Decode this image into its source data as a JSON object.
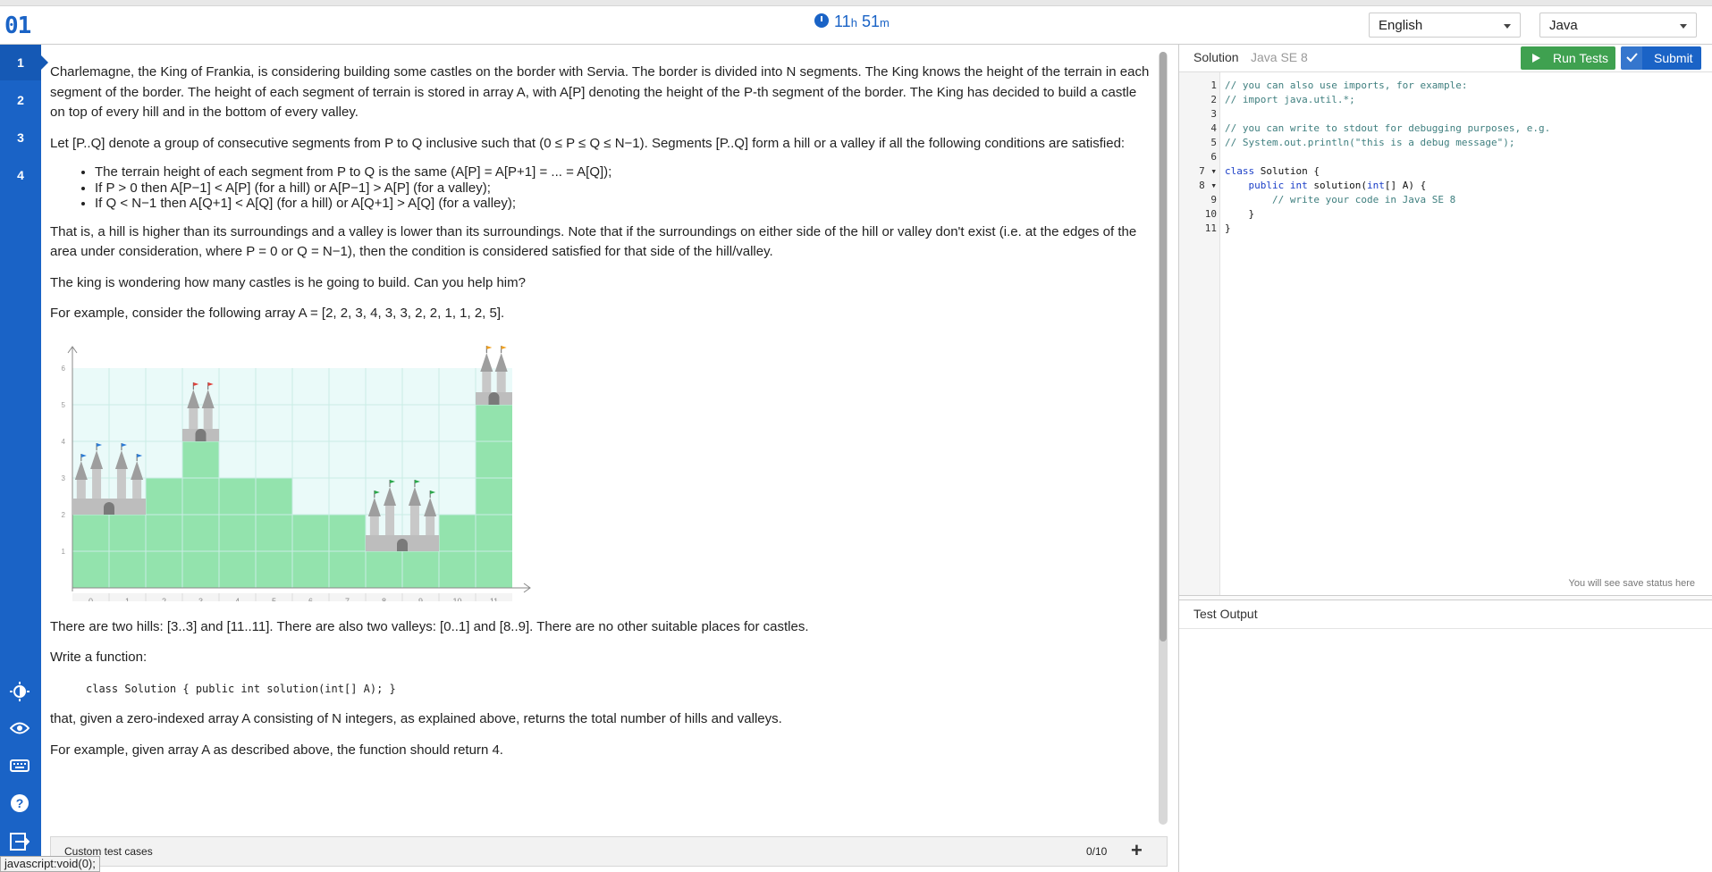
{
  "header": {
    "logo": "01",
    "timer_hours": "11",
    "timer_h_unit": "h",
    "timer_minutes": "51",
    "timer_m_unit": "m",
    "language_select": "English",
    "prog_language_select": "Java"
  },
  "sidebar": {
    "tasks": [
      "1",
      "2",
      "3",
      "4"
    ],
    "icons": [
      "brightness-icon",
      "eye-icon",
      "keyboard-icon",
      "help-icon",
      "exit-icon"
    ]
  },
  "description": {
    "p1": "Charlemagne, the King of Frankia, is considering building some castles on the border with Servia. The border is divided into N segments. The King knows the height of the terrain in each segment of the border. The height of each segment of terrain is stored in array A, with A[P] denoting the height of the P-th segment of the border. The King has decided to build a castle on top of every hill and in the bottom of every valley.",
    "p2": "Let [P..Q] denote a group of consecutive segments from P to Q inclusive such that (0 ≤ P ≤ Q ≤ N−1). Segments [P..Q] form a hill or a valley if all the following conditions are satisfied:",
    "bullets": [
      "The terrain height of each segment from P to Q is the same (A[P] = A[P+1] = ... = A[Q]);",
      "If P > 0 then A[P−1] < A[P] (for a hill) or A[P−1] > A[P] (for a valley);",
      "If Q < N−1 then A[Q+1] < A[Q] (for a hill) or A[Q+1] > A[Q] (for a valley);"
    ],
    "p3": "That is, a hill is higher than its surroundings and a valley is lower than its surroundings. Note that if the surroundings on either side of the hill or valley don't exist (i.e. at the edges of the area under consideration, where P = 0 or Q = N−1), then the condition is considered satisfied for that side of the hill/valley.",
    "p4": "The king is wondering how many castles is he going to build. Can you help him?",
    "p5": "For example, consider the following array A = [2, 2, 3, 4, 3, 3, 2, 2, 1, 1, 2, 5].",
    "p6": "There are two hills: [3..3] and [11..11]. There are also two valleys: [0..1] and [8..9]. There are no other suitable places for castles.",
    "p7": "Write a function:",
    "code": "class Solution { public int solution(int[] A); }",
    "p8": "that, given a zero-indexed array A consisting of N integers, as explained above, returns the total number of hills and valleys.",
    "p9": "For example, given array A as described above, the function should return 4."
  },
  "chart_data": {
    "type": "bar",
    "categories": [
      "0",
      "1",
      "2",
      "3",
      "4",
      "5",
      "6",
      "7",
      "8",
      "9",
      "10",
      "11"
    ],
    "values": [
      2,
      2,
      3,
      4,
      3,
      3,
      2,
      2,
      1,
      1,
      2,
      5
    ],
    "xlabel": "",
    "ylabel": "",
    "ylim": [
      0,
      6
    ],
    "yticks": [
      "1",
      "2",
      "3",
      "4",
      "5",
      "6"
    ],
    "grid": true,
    "castles": [
      {
        "segments": [
          0,
          1
        ],
        "flag_color": "#2b7bd6"
      },
      {
        "segments": [
          3
        ],
        "flag_color": "#e0403a"
      },
      {
        "segments": [
          8,
          9
        ],
        "flag_color": "#2aa84a"
      },
      {
        "segments": [
          11
        ],
        "flag_color": "#f0a020"
      }
    ],
    "bar_color": "#93e3ad",
    "bg_color": "#eafaf9"
  },
  "custom_tests": {
    "label": "Custom test cases",
    "count": "0/10",
    "add": "+"
  },
  "statusbar": "javascript:void(0);",
  "editor": {
    "tab_label": "Solution",
    "lang_label": "Java SE 8",
    "run_label": "Run Tests",
    "submit_label": "Submit",
    "line_numbers": [
      "1",
      "2",
      "3",
      "4",
      "5",
      "6",
      "7",
      "8",
      "9",
      "10",
      "11"
    ],
    "fold_marks": [
      "",
      "",
      "",
      "",
      "",
      "",
      "▾",
      "▾",
      "",
      "",
      ""
    ],
    "lines": [
      "// you can also use imports, for example:",
      "// import java.util.*;",
      "",
      "// you can write to stdout for debugging purposes, e.g.",
      "// System.out.println(\"this is a debug message\");",
      "",
      "class Solution {",
      "    public int solution(int[] A) {",
      "        // write your code in Java SE 8",
      "    }",
      "}"
    ],
    "save_status": "You will see save status here"
  },
  "test_output": {
    "title": "Test Output"
  }
}
